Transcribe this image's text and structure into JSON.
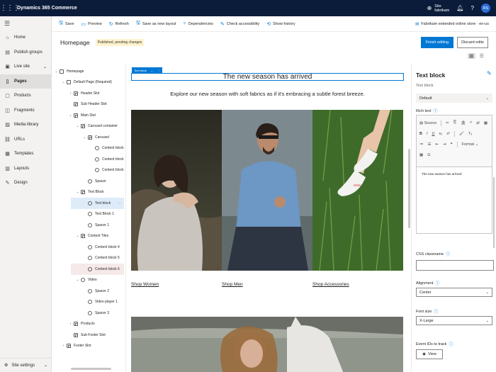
{
  "app": {
    "title": "Dynamics 365 Commerce",
    "site_label_1": "Site",
    "site_label_2": "fabrikam",
    "avatar_initials": "RS"
  },
  "nav": {
    "items": [
      {
        "label": "Home",
        "icon": "home-icon"
      },
      {
        "label": "Publish groups",
        "icon": "publish-icon"
      },
      {
        "label": "Live site",
        "icon": "live-site-icon"
      },
      {
        "label": "Pages",
        "icon": "pages-icon"
      },
      {
        "label": "Products",
        "icon": "products-icon"
      },
      {
        "label": "Fragments",
        "icon": "fragments-icon"
      },
      {
        "label": "Media library",
        "icon": "media-icon"
      },
      {
        "label": "URLs",
        "icon": "url-icon"
      },
      {
        "label": "Templates",
        "icon": "templates-icon"
      },
      {
        "label": "Layouts",
        "icon": "layouts-icon"
      },
      {
        "label": "Design",
        "icon": "design-icon"
      }
    ],
    "settings_label": "Site settings"
  },
  "toolbar": {
    "save": "Save",
    "preview": "Preview",
    "refresh": "Refresh",
    "save_layout": "Save as new layout",
    "dependencies": "Dependencies",
    "accessibility": "Check accessibility",
    "history": "Show history",
    "store": "Fabrikam extended online store · en-us"
  },
  "page": {
    "title": "Homepage",
    "status": "Published, pending changes",
    "finish_label": "Finish editing",
    "discard_label": "Discard edits"
  },
  "tree": {
    "rows": [
      {
        "label": "Homepage"
      },
      {
        "label": "Default Page (Required)"
      },
      {
        "label": "Header Slot"
      },
      {
        "label": "Sub Header Slot"
      },
      {
        "label": "Main Slot"
      },
      {
        "label": "Carousel container"
      },
      {
        "label": "Carousel"
      },
      {
        "label": "Content block"
      },
      {
        "label": "Content block"
      },
      {
        "label": "Content block"
      },
      {
        "label": "Spacer"
      },
      {
        "label": "Text Block"
      },
      {
        "label": "Text block"
      },
      {
        "label": "Text Block 1"
      },
      {
        "label": "Spacer 1"
      },
      {
        "label": "Content Tiles"
      },
      {
        "label": "Content block 4"
      },
      {
        "label": "Content block 5"
      },
      {
        "label": "Content block 6"
      },
      {
        "label": "Video"
      },
      {
        "label": "Spacer 2"
      },
      {
        "label": "Video player 1"
      },
      {
        "label": "Spacer 3"
      },
      {
        "label": "Products"
      },
      {
        "label": "Sub Footer Slot"
      },
      {
        "label": "Footer Slot"
      }
    ]
  },
  "canvas": {
    "chip_label": "Text block",
    "headline": "The new season has arrived",
    "subtitle": "Explore our new season with soft fabrics as if it's embracing a subtle forest breeze.",
    "links": [
      "Shop Women",
      "Shop Men",
      "Shop Accessories"
    ]
  },
  "props": {
    "heading": "Text block",
    "type_label": "Text block",
    "variant": "Default",
    "rich_text_label": "Rich text",
    "source_label": "Source",
    "format_label": "Format",
    "rich_text_value": "The new season has arrived",
    "css_label": "CSS classname",
    "align_label": "Alignment",
    "align_value": "Center",
    "font_label": "Font size",
    "font_value": "X-Large",
    "track_label": "Event IDs to track",
    "view_label": "View"
  }
}
